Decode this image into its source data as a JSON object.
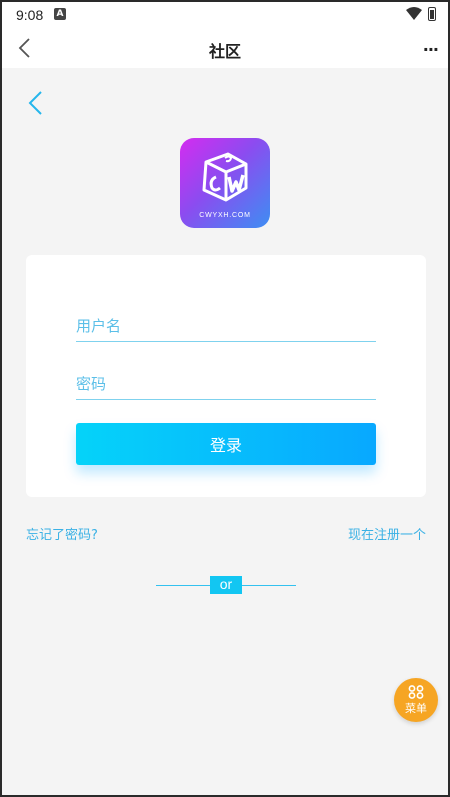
{
  "status_bar": {
    "time": "9:08",
    "notification_icon": "A"
  },
  "navbar": {
    "title": "社区",
    "more": "···"
  },
  "logo": {
    "text": "CWYXH.COM"
  },
  "form": {
    "username_placeholder": "用户名",
    "password_placeholder": "密码",
    "login_label": "登录"
  },
  "links": {
    "forgot": "忘记了密码?",
    "register": "现在注册一个"
  },
  "divider": {
    "text": "or"
  },
  "menu_fab": {
    "label": "菜单"
  },
  "colors": {
    "accent": "#08a8ff",
    "link": "#3ab1e5",
    "fab": "#f6a523"
  }
}
